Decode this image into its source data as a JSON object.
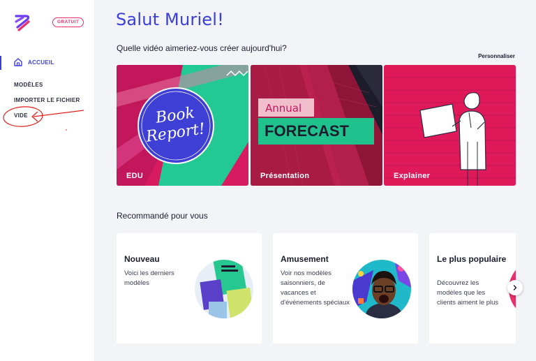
{
  "sidebar": {
    "badge": "GRATUIT",
    "home_label": "ACCUEIL",
    "items": [
      {
        "label": "MODÈLES"
      },
      {
        "label": "IMPORTER LE FICHIER"
      },
      {
        "label": "VIDE"
      }
    ]
  },
  "main": {
    "greeting": "Salut Muriel!",
    "question": "Quelle vidéo aimeriez-vous créer aujourd'hui?",
    "personalize": "Personnaliser",
    "video_cards": [
      {
        "label": "EDU",
        "art_line1": "Book",
        "art_line2": "Report!"
      },
      {
        "label": "Présentation",
        "art_line1": "Annual",
        "art_line2": "FORECAST"
      },
      {
        "label": "Explainer"
      }
    ],
    "recommended_title": "Recommandé pour vous",
    "recommended": [
      {
        "title": "Nouveau",
        "description": "Voici les derniers modèles"
      },
      {
        "title": "Amusement",
        "description": "Voir nos modèles saisonniers, de vacances et d'événements spéciaux"
      },
      {
        "title": "Le plus populaire",
        "description": "Découvrez les modèles que les clients aiment le plus"
      }
    ]
  },
  "colors": {
    "accent": "#3a3fd8",
    "badge": "#e8306b",
    "card_magenta": "#c2185b",
    "annotation_red": "#e0201b"
  },
  "icons": [
    "app-logo-icon",
    "home-icon",
    "chevron-right-icon"
  ]
}
